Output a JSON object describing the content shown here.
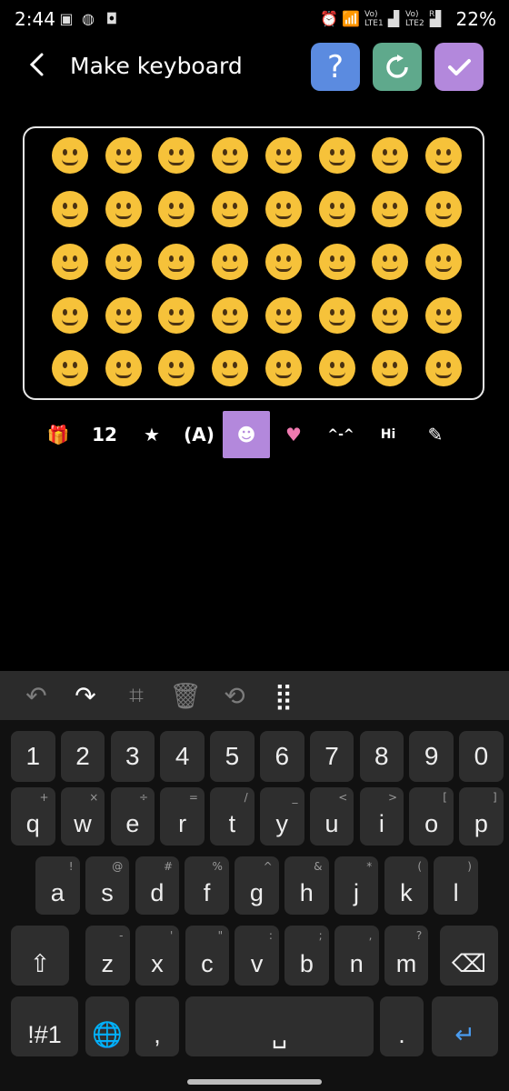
{
  "status": {
    "time": "2:44",
    "battery": "22%",
    "sim1": "LTE1",
    "sim2": "LTE2",
    "volte": "Vo)",
    "roaming": "R"
  },
  "header": {
    "title": "Make keyboard",
    "help_icon": "question-icon",
    "reset_icon": "refresh-icon",
    "confirm_icon": "checkmark-icon"
  },
  "emoji_rows": [
    [
      "😀",
      "😃",
      "😄",
      "😁",
      "😆",
      "😅",
      "🤣",
      "😂"
    ],
    [
      "🙂",
      "🙃",
      "😉",
      "😊",
      "😇",
      "🥰",
      "😍",
      "🤩"
    ],
    [
      "😘",
      "😗",
      "☺️",
      "😚",
      "😙",
      "🥲",
      "😋",
      "😛"
    ],
    [
      "😜",
      "🤪",
      "😝",
      "🤑",
      "🤗",
      "🤭",
      "🤫",
      "🤔"
    ],
    [
      "🤐",
      "🤨",
      "😐",
      "😑",
      "😶",
      "😏",
      "😒",
      "🙄"
    ]
  ],
  "categories": [
    {
      "name": "cat-gift",
      "label": "🎁"
    },
    {
      "name": "cat-numbers",
      "label": "12"
    },
    {
      "name": "cat-favorites",
      "label": "★"
    },
    {
      "name": "cat-text",
      "label": "(A)"
    },
    {
      "name": "cat-emoji",
      "label": "☻"
    },
    {
      "name": "cat-heart",
      "label": "♥"
    },
    {
      "name": "cat-emoticon",
      "label": "^-^"
    },
    {
      "name": "cat-hi",
      "label": "Hi"
    },
    {
      "name": "cat-edit",
      "label": "✎"
    }
  ],
  "toolbar": [
    {
      "name": "undo-icon",
      "glyph": "↶",
      "active": false
    },
    {
      "name": "redo-icon",
      "glyph": "↷",
      "active": true
    },
    {
      "name": "keycap-icon",
      "glyph": "⌗",
      "active": false
    },
    {
      "name": "delete-icon",
      "glyph": "🗑",
      "active": false
    },
    {
      "name": "swap-icon",
      "glyph": "⟲",
      "active": false
    },
    {
      "name": "grid-sort-icon",
      "glyph": "⣿",
      "active": true
    }
  ],
  "keys": {
    "row0": [
      {
        "m": "1"
      },
      {
        "m": "2"
      },
      {
        "m": "3"
      },
      {
        "m": "4"
      },
      {
        "m": "5"
      },
      {
        "m": "6"
      },
      {
        "m": "7"
      },
      {
        "m": "8"
      },
      {
        "m": "9"
      },
      {
        "m": "0"
      }
    ],
    "row1": [
      {
        "m": "q",
        "s": "+"
      },
      {
        "m": "w",
        "s": "×"
      },
      {
        "m": "e",
        "s": "÷"
      },
      {
        "m": "r",
        "s": "="
      },
      {
        "m": "t",
        "s": "/"
      },
      {
        "m": "y",
        "s": "_"
      },
      {
        "m": "u",
        "s": "<"
      },
      {
        "m": "i",
        "s": ">"
      },
      {
        "m": "o",
        "s": "["
      },
      {
        "m": "p",
        "s": "]"
      }
    ],
    "row2": [
      {
        "m": "a",
        "s": "!"
      },
      {
        "m": "s",
        "s": "@"
      },
      {
        "m": "d",
        "s": "#"
      },
      {
        "m": "f",
        "s": "%"
      },
      {
        "m": "g",
        "s": "^"
      },
      {
        "m": "h",
        "s": "&"
      },
      {
        "m": "j",
        "s": "*"
      },
      {
        "m": "k",
        "s": "("
      },
      {
        "m": "l",
        "s": ")"
      }
    ],
    "row3": [
      {
        "m": "z",
        "s": "-"
      },
      {
        "m": "x",
        "s": "'"
      },
      {
        "m": "c",
        "s": "\""
      },
      {
        "m": "v",
        "s": ":"
      },
      {
        "m": "b",
        "s": ";"
      },
      {
        "m": "n",
        "s": ","
      },
      {
        "m": "m",
        "s": "?"
      }
    ],
    "shift": "⇧",
    "backspace": "⌫",
    "symbols": "!#1",
    "globe": "🌐",
    "comma": ",",
    "period": ".",
    "enter": "↵",
    "space": "␣"
  }
}
